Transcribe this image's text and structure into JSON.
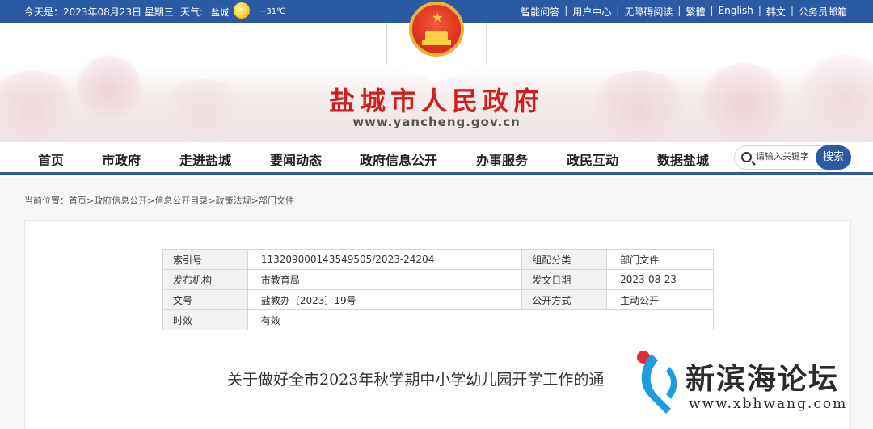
{
  "topbar": {
    "date": "今天是：2023年08月23日 星期三",
    "weather_label": "天气:",
    "city": "盐城",
    "temperature": "~31℃",
    "links": [
      "智能问答",
      "用户中心",
      "无障碍阅读",
      "繁體",
      "English",
      "韩文",
      "公务员邮箱"
    ]
  },
  "banner": {
    "title": "盐城市人民政府",
    "url": "www.yancheng.gov.cn"
  },
  "nav": {
    "items": [
      "首页",
      "市政府",
      "走进盐城",
      "要闻动态",
      "政府信息公开",
      "办事服务",
      "政民互动",
      "数据盐城"
    ],
    "search_placeholder": "请输入关键字",
    "search_button": "搜索"
  },
  "breadcrumb": {
    "prefix": "当前位置：",
    "items": [
      "首页",
      "政府信息公开",
      "信息公开目录",
      "政策法规",
      "部门文件"
    ],
    "separator": ">"
  },
  "meta": {
    "rows": [
      {
        "k1": "索引号",
        "v1": "113209000143549505/2023-24204",
        "k2": "组配分类",
        "v2": "部门文件"
      },
      {
        "k1": "发布机构",
        "v1": "市教育局",
        "k2": "发文日期",
        "v2": "2023-08-23"
      },
      {
        "k1": "文号",
        "v1": "盐教办〔2023〕19号",
        "k2": "公开方式",
        "v2": "主动公开"
      },
      {
        "k1": "时效",
        "v1": "有效"
      }
    ]
  },
  "document": {
    "title": "关于做好全市2023年秋学期中小学幼儿园开学工作的通"
  },
  "watermark": {
    "title": "新滨海论坛",
    "url": "www.xbhwang.com"
  },
  "colors": {
    "primary_blue": "#2b5aa5",
    "title_red": "#cf1f1f"
  }
}
